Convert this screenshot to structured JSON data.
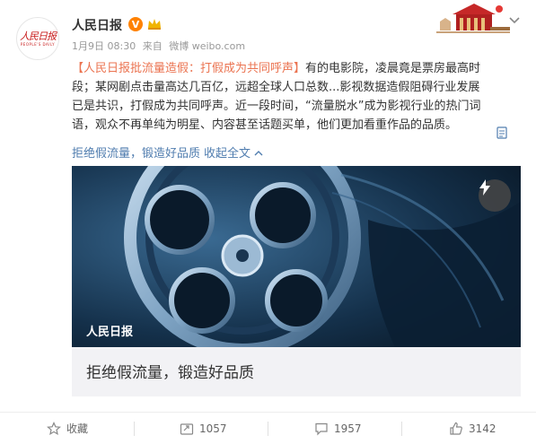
{
  "post": {
    "author": "人民日报",
    "verified_badge": "V",
    "date": "1月9日 08:30",
    "source_prefix": "来自",
    "source": "微博 weibo.com",
    "lines": [
      {
        "topic": "【人民日报批流量造假：打假成为共同呼声】",
        "rest": "有的电影院，凌晨竟是票房最高时"
      },
      {
        "text": "段；某网剧点击量高达几百亿，远超全球人口总数...影视数据造假阻碍行业发展"
      },
      {
        "text": "已是共识，打假成为共同呼声。近一段时间，“流量脱水”成为影视行业的热门词"
      },
      {
        "text": "语，观众不再单纯为明星、内容甚至话题买单，他们更加看重作品的品质。"
      }
    ],
    "collapse": {
      "quote": "拒绝假流量，锻造好品质",
      "collapse_label": "收起全文",
      "chevron": "^"
    },
    "icons": {
      "more": "chevron-down-icon",
      "note": "note-icon",
      "bolt": "lightning-icon",
      "vip": "vip-crown-icon"
    }
  },
  "card": {
    "brand": "人民日报",
    "caption": "拒绝假流量，锻造好品质"
  },
  "avatar": {
    "logo": "人民日报",
    "sub": "PEOPLE'S DAILY"
  },
  "actions": {
    "favorite": "收藏",
    "repost_count": "1057",
    "comment_count": "1957",
    "like_count": "3142"
  },
  "colors": {
    "link_orange": "#eb7350",
    "link_blue": "#507daf",
    "brand_red": "#c81e1e",
    "verified_orange": "#ff8200"
  }
}
